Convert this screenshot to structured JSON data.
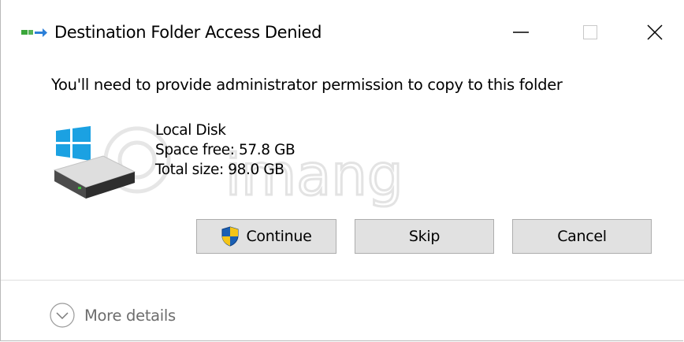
{
  "window": {
    "title": "Destination Folder Access Denied",
    "controls": {
      "minimize": "minimize-icon",
      "maximize": "maximize-icon",
      "close": "close-icon"
    }
  },
  "message": {
    "instruction": "You'll need to provide administrator permission to copy to this folder"
  },
  "drive": {
    "icon": "local-disk-icon",
    "name": "Local Disk",
    "space_free": "Space free: 57.8 GB",
    "total_size": "Total size: 98.0 GB"
  },
  "buttons": {
    "continue_label": "Continue",
    "continue_icon": "uac-shield-icon",
    "skip_label": "Skip",
    "cancel_label": "Cancel"
  },
  "footer": {
    "more_details_label": "More details",
    "more_details_icon": "chevron-down-circle-icon"
  },
  "colors": {
    "windows_blue": "#1ba1e2",
    "button_face": "#e1e1e1",
    "button_border": "#adadad",
    "muted_text": "#6d6d6d"
  }
}
